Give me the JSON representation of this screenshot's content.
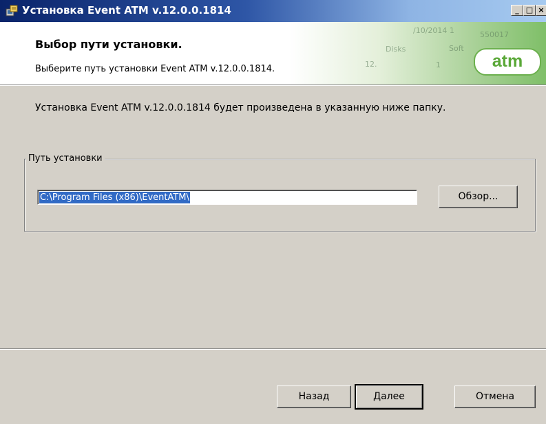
{
  "window": {
    "title": "Установка Event ATM v.12.0.0.1814",
    "controls": {
      "minimize": "_",
      "maximize": "□",
      "close": "×"
    }
  },
  "header": {
    "title": "Выбор пути установки.",
    "subtitle": "Выберите путь установки Event ATM v.12.0.0.1814.",
    "logo_text": "atm",
    "banner_snippets": {
      "date": "/10/2014 1",
      "number": "550017",
      "disks": "Disks",
      "soft": "Soft",
      "row_a": "12.",
      "row_b": "1"
    }
  },
  "body": {
    "description": "Установка Event ATM v.12.0.0.1814 будет произведена в указанную ниже папку.",
    "install_path_group": {
      "label": "Путь установки",
      "path_value": "C:\\Program Files (x86)\\EventATM\\",
      "browse_label": "Обзор..."
    }
  },
  "footer": {
    "back_label": "Назад",
    "next_label": "Далее",
    "cancel_label": "Отмена"
  },
  "colors": {
    "titlebar_start": "#0a246a",
    "dialog_bg": "#d4d0c8",
    "selection": "#316ac5",
    "brand_green": "#5aa838"
  }
}
